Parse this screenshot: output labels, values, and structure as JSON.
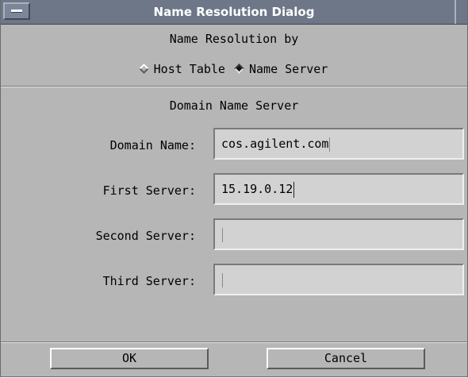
{
  "window": {
    "title": "Name Resolution Dialog"
  },
  "resolution": {
    "heading": "Name Resolution by",
    "options": [
      {
        "label": "Host Table",
        "selected": false
      },
      {
        "label": "Name Server",
        "selected": true
      }
    ]
  },
  "dns": {
    "heading": "Domain Name Server",
    "fields": [
      {
        "label": "Domain Name:",
        "value": "cos.agilent.com"
      },
      {
        "label": "First Server:",
        "value": "15.19.0.12"
      },
      {
        "label": "Second Server:",
        "value": ""
      },
      {
        "label": "Third Server:",
        "value": ""
      }
    ]
  },
  "buttons": {
    "ok": "OK",
    "cancel": "Cancel"
  },
  "colors": {
    "titlebar": "#6d7788",
    "dialog_bg": "#b6b6b6",
    "field_bg": "#d2d2d2"
  }
}
